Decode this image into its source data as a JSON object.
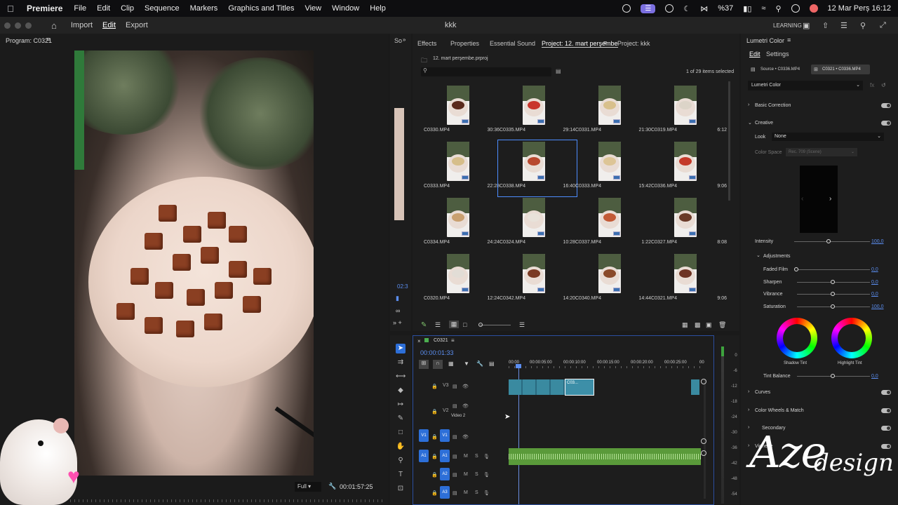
{
  "menubar": {
    "app": "Premiere",
    "items": [
      "File",
      "Edit",
      "Clip",
      "Sequence",
      "Markers",
      "Graphics and Titles",
      "View",
      "Window",
      "Help"
    ],
    "battery": "%37",
    "datetime": "12 Mar Perș 16:12"
  },
  "header": {
    "import": "Import",
    "edit": "Edit",
    "export": "Export",
    "project_name": "kkk",
    "learning": "LEARNING"
  },
  "program": {
    "title": "Program: C0321",
    "fit": "Full",
    "timecode": "00:01:57:25"
  },
  "source_strip": {
    "label": "So",
    "timecode": "02:3"
  },
  "project": {
    "tabs": [
      "Effects",
      "Properties",
      "Essential Sound",
      "Project: 12. mart perşembe",
      "Project: kkk"
    ],
    "bin_name": "12. mart perşembe.prproj",
    "count": "1 of 29 items selected",
    "clips": [
      {
        "name": "C0330.MP4",
        "dur": "30:36",
        "food": "#5a2a1c"
      },
      {
        "name": "C0335.MP4",
        "dur": "29:14",
        "food": "#c9352c"
      },
      {
        "name": "C0331.MP4",
        "dur": "21:30",
        "food": "#d8c08c"
      },
      {
        "name": "C0319.MP4",
        "dur": "6:12",
        "food": "#dcd4c8"
      },
      {
        "name": "C0333.MP4",
        "dur": "22:28",
        "food": "#d6be8a"
      },
      {
        "name": "C0338.MP4",
        "dur": "16:40",
        "food": "#b8482e"
      },
      {
        "name": "C0333.MP4",
        "dur": "15:42",
        "food": "#ddc596"
      },
      {
        "name": "C0336.MP4",
        "dur": "9:06",
        "food": "#c43a2a"
      },
      {
        "name": "C0334.MP4",
        "dur": "24:24",
        "food": "#c9a070"
      },
      {
        "name": "C0324.MP4",
        "dur": "10:28",
        "food": "#e8e2da"
      },
      {
        "name": "C0337.MP4",
        "dur": "1:22",
        "food": "#c25a36"
      },
      {
        "name": "C0327.MP4",
        "dur": "8:08",
        "food": "#6a3a28"
      },
      {
        "name": "C0320.MP4",
        "dur": "12:24",
        "food": "#e2ddd6"
      },
      {
        "name": "C0342.MP4",
        "dur": "14:20",
        "food": "#7a3a24"
      },
      {
        "name": "C0340.MP4",
        "dur": "14:44",
        "food": "#8a4a2a"
      },
      {
        "name": "C0321.MP4",
        "dur": "9:06",
        "food": "#6e3424"
      }
    ]
  },
  "timeline": {
    "seq_name": "C0321",
    "timecode": "00:00:01:33",
    "ruler": [
      "00:00",
      "00:00:05:00",
      "00:00:10:00",
      "00:00:15:00",
      "00:00:20:00",
      "00:00:25:00",
      "00"
    ],
    "tracks": [
      "V3",
      "V2",
      "V1",
      "A1",
      "A2",
      "A3"
    ],
    "video2_label": "Video 2",
    "clip_label": "C03..."
  },
  "meters": [
    "0",
    "-6",
    "-12",
    "-18",
    "-24",
    "-30",
    "-36",
    "-42",
    "-48",
    "-54"
  ],
  "lumetri": {
    "title": "Lumetri Color",
    "tabs": [
      "Edit",
      "Settings"
    ],
    "source": "Source • C0336.MP4",
    "target": "C0321 • C0336.MP4",
    "effect": "Lumetri Color",
    "basic": "Basic Correction",
    "creative": "Creative",
    "look_label": "Look",
    "look_value": "None",
    "colorspace_label": "Color Space",
    "colorspace_value": "Rec. 709 (Scene)",
    "intensity": "Intensity",
    "intensity_val": "100,0",
    "adjustments": "Adjustments",
    "faded": "Faded Film",
    "faded_val": "0,0",
    "sharpen": "Sharpen",
    "sharpen_val": "0,0",
    "vibrance": "Vibrance",
    "vibrance_val": "0,0",
    "saturation": "Saturation",
    "saturation_val": "100,0",
    "shadow_tint": "Shadow Tint",
    "highlight_tint": "Highlight Tint",
    "tint_balance": "Tint Balance",
    "tint_balance_val": "0,0",
    "curves": "Curves",
    "wheels": "Color Wheels & Match",
    "secondary": "Secondary",
    "vignette": "Vignette"
  },
  "watermark": {
    "line1": "Aze",
    "line2": "design"
  }
}
